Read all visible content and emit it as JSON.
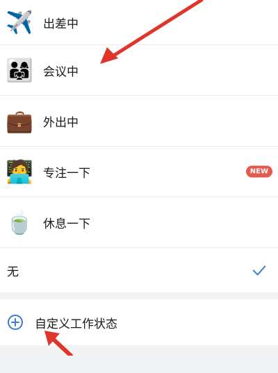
{
  "statuses": [
    {
      "icon": "airplane-icon",
      "emoji": "✈️",
      "label": "出差中"
    },
    {
      "icon": "meeting-people-icon",
      "emoji": "👨‍👩‍👧",
      "label": "会议中"
    },
    {
      "icon": "briefcase-icon",
      "emoji": "💼",
      "label": "外出中"
    },
    {
      "icon": "laptop-face-icon",
      "emoji": "🧑‍💻",
      "label": "专注一下",
      "badge": "NEW"
    },
    {
      "icon": "teacup-icon",
      "emoji": "🍵",
      "label": "休息一下"
    }
  ],
  "none_option": {
    "label": "无",
    "selected": true
  },
  "custom": {
    "label": "自定义工作状态",
    "icon": "plus-circle-icon"
  },
  "colors": {
    "accent": "#3a7bd5",
    "badge": "#e35a4f",
    "annotation_arrow": "#e0352b"
  }
}
